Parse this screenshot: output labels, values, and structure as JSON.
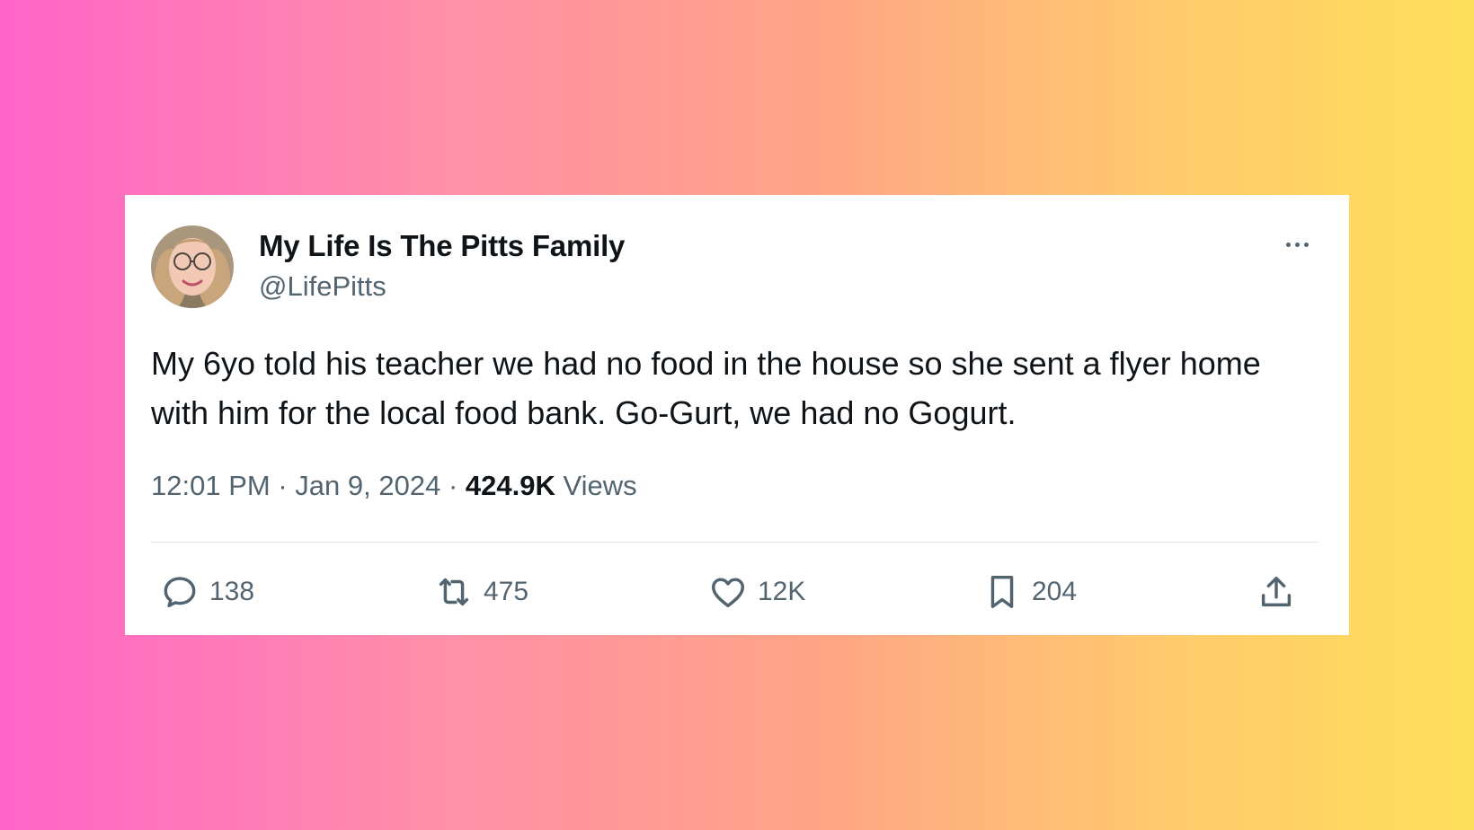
{
  "tweet": {
    "display_name": "My Life Is The Pitts Family",
    "handle": "@LifePitts",
    "text": "My 6yo told his teacher we had no food in the house so she sent a flyer home with him for the local food bank. Go-Gurt, we had no Gogurt.",
    "time": "12:01 PM",
    "date": "Jan 9, 2024",
    "views_count": "424.9K",
    "views_label": "Views",
    "separator": "·"
  },
  "actions": {
    "replies": "138",
    "reposts": "475",
    "likes": "12K",
    "bookmarks": "204"
  },
  "icons": {
    "reply": "reply-bubble-icon",
    "repost": "repost-arrows-icon",
    "like": "heart-icon",
    "bookmark": "bookmark-icon",
    "share": "share-upload-icon",
    "more": "more-dots-icon"
  },
  "colors": {
    "text_primary": "#0f1419",
    "text_secondary": "#536471",
    "divider": "#e1e8ed",
    "background_left": "#ff64c8",
    "background_right": "#ffdf5a"
  }
}
